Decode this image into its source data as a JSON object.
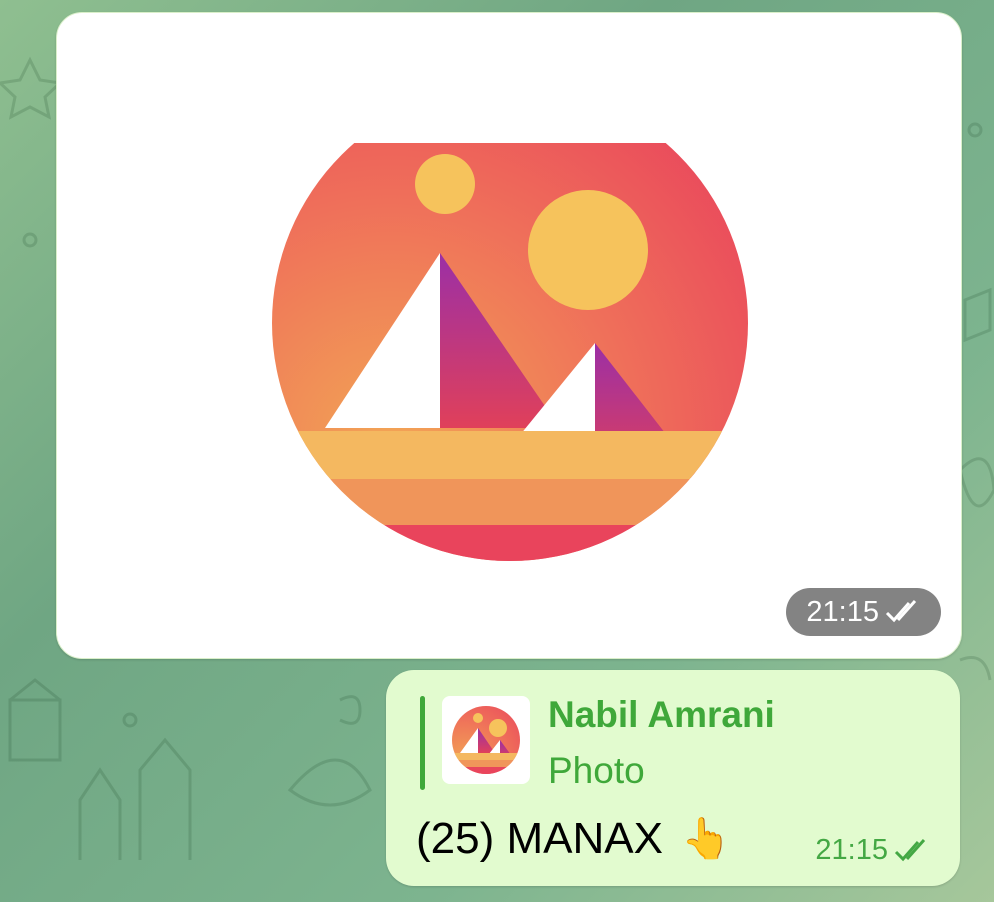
{
  "photo_message": {
    "time": "21:15",
    "status_icon": "double-check-icon"
  },
  "reply_message": {
    "quote": {
      "author": "Nabil Amrani",
      "type": "Photo",
      "thumbnail_icon": "decentraland-logo-icon"
    },
    "text": "(25) MANAX",
    "emoji": "👆",
    "time": "21:15",
    "status_icon": "double-check-icon"
  },
  "colors": {
    "accent_green": "#3fa83a",
    "bubble_green": "#e2fbcf",
    "time_pill": "#5a5a5a"
  }
}
